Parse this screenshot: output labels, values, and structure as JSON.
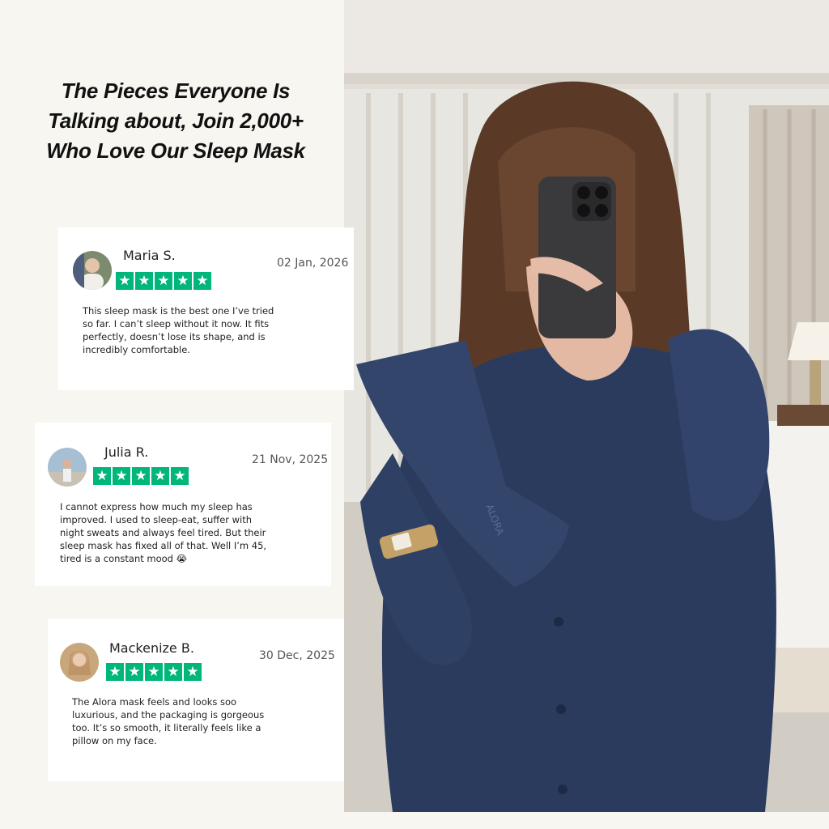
{
  "headline": {
    "line1": "The Pieces Everyone Is",
    "line2": "Talking about, Join 2,000+",
    "line3": "Who Love Our Sleep Mask"
  },
  "reviews": [
    {
      "name": "Maria S.",
      "date": "02 Jan, 2026",
      "rating": 5,
      "text": "This sleep mask is the best one I’ve tried so far. I can’t sleep without it now. It fits perfectly, doesn’t lose its shape, and is incredibly comfortable."
    },
    {
      "name": "Julia R.",
      "date": "21 Nov, 2025",
      "rating": 5,
      "text": "I cannot express how much my sleep has improved. I used to sleep-eat, suffer with night sweats and always feel tired. But their sleep mask has fixed all of that. Well I’m 45, tired is a constant mood 😭"
    },
    {
      "name": "Mackenize B.",
      "date": "30 Dec, 2025",
      "rating": 5,
      "text": "The Alora mask feels and looks soo luxurious, and the packaging is gorgeous too. It’s so smooth, it literally feels like a pillow on my face."
    }
  ],
  "star_glyph": "★",
  "mask_brand": "ALORA",
  "colors": {
    "star_bg": "#00b67a",
    "panel_bg": "#f7f6f1",
    "pajama": "#2b3b5e"
  }
}
